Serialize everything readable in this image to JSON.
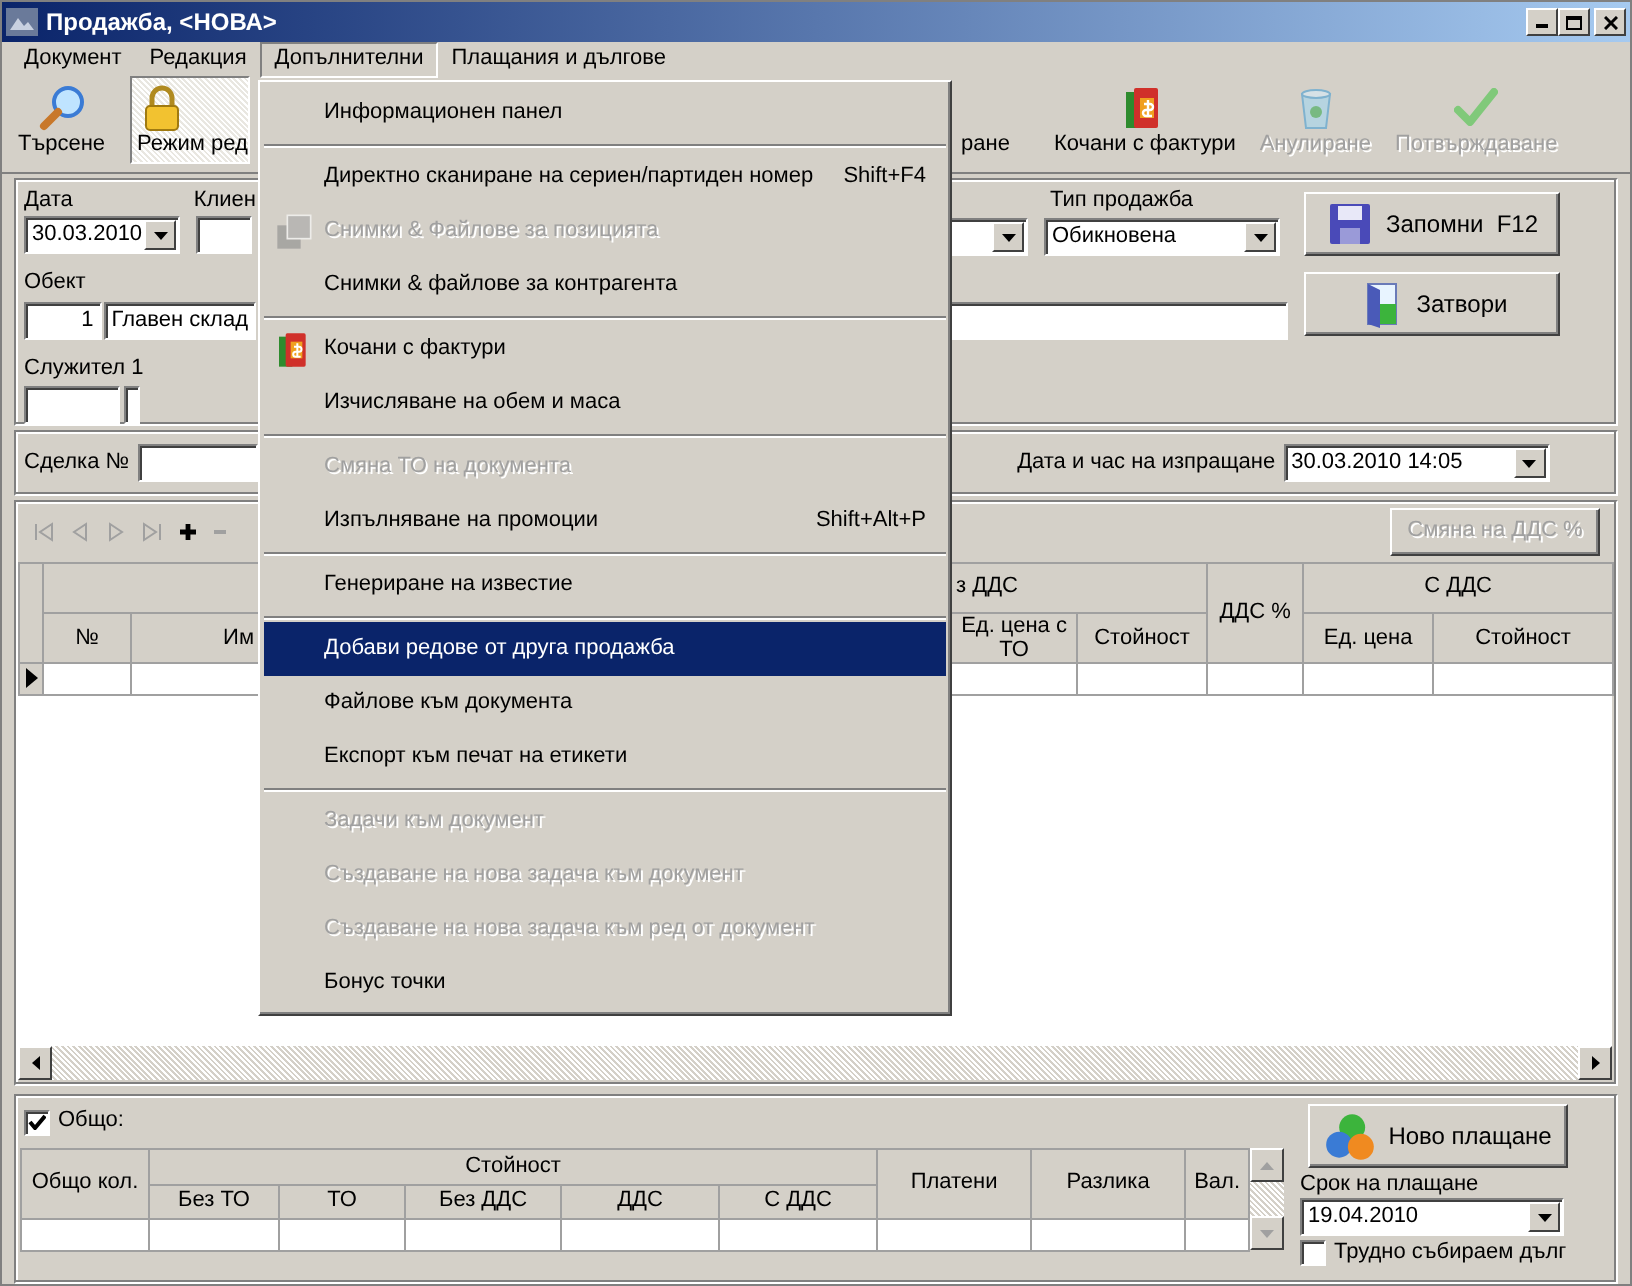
{
  "window": {
    "title": "Продажба, <НОВА>"
  },
  "menu_bar": [
    {
      "label": "Документ",
      "selected": false
    },
    {
      "label": "Редакция",
      "selected": false
    },
    {
      "label": "Допълнителни",
      "selected": true
    },
    {
      "label": "Плащания и дългове",
      "selected": false
    }
  ],
  "toolbar_left": [
    {
      "label": "Търсене",
      "kind": "search",
      "pressed": false,
      "disabled": false
    },
    {
      "label": "Режим ред",
      "kind": "lock",
      "pressed": true,
      "disabled": false
    }
  ],
  "toolbar_right": [
    {
      "label": "ране",
      "pressed": false,
      "disabled": false
    },
    {
      "label": "Кочани с фактури",
      "kind": "books",
      "pressed": false,
      "disabled": false
    },
    {
      "label": "Анулиране",
      "kind": "bin",
      "pressed": false,
      "disabled": true
    },
    {
      "label": "Потвърждаване",
      "kind": "check",
      "pressed": false,
      "disabled": true
    }
  ],
  "header": {
    "date": {
      "label": "Дата",
      "value": "30.03.2010"
    },
    "client": {
      "label": "Клиен"
    },
    "sale_type": {
      "label": "Тип продажба",
      "value": "Обикновена"
    },
    "object": {
      "label": "Обект",
      "number": "1",
      "name": "Главен склад"
    },
    "employee": {
      "label": "Служител 1"
    },
    "buttons": [
      {
        "label": "Запомни  F12",
        "kind": "floppy"
      },
      {
        "label": "Затвори",
        "kind": "door"
      }
    ]
  },
  "deal": {
    "label": "Сделка №"
  },
  "send_datetime": {
    "label": "Дата и час на изпращане",
    "value": "30.03.2010 14:05"
  },
  "grid": {
    "vat_button": {
      "label": "Смяна на ДДС %",
      "disabled": true
    },
    "number_column": "№",
    "name_column": "Им",
    "group_partial": "з ДДС",
    "group_columns": [
      "Ед. цена с ТО",
      "Стойност"
    ],
    "vat_column": "ДДС %",
    "with_vat": {
      "label": "С ДДС",
      "columns": [
        "Ед. цена",
        "Стойност"
      ]
    },
    "rows": [
      {
        "selected": true
      }
    ]
  },
  "totals": {
    "checkbox": {
      "label": "Общо:",
      "checked": true
    },
    "qty_column": "Общо кол.",
    "value_group": "Стойност",
    "value_columns": [
      "Без ТО",
      "ТО",
      "Без ДДС",
      "ДДС",
      "С ДДС"
    ],
    "paid_column": "Платени",
    "diff_column": "Разлика",
    "currency_column": "Вал."
  },
  "payment": {
    "button": "Ново плащане",
    "due": {
      "label": "Срок на плащане",
      "value": "19.04.2010"
    },
    "bad_debt": {
      "label": "Трудно събираем дълг",
      "checked": false
    }
  },
  "dropdown_menu": {
    "sections": [
      [
        {
          "label": "Информационен панел",
          "disabled": false,
          "selected": false
        }
      ],
      [
        {
          "label": "Директно сканиране на сериен/партиден номер",
          "shortcut": "Shift+F4",
          "disabled": false,
          "selected": false
        },
        {
          "label": "Снимки & Файлове за позицията",
          "kind": "photos",
          "disabled": true,
          "selected": false
        },
        {
          "label": "Снимки & файлове за контрагента",
          "disabled": false,
          "selected": false
        }
      ],
      [
        {
          "label": "Кочани с фактури",
          "kind": "books",
          "disabled": false,
          "selected": false
        },
        {
          "label": "Изчисляване на обем и маса",
          "disabled": false,
          "selected": false
        }
      ],
      [
        {
          "label": "Смяна ТО на документа",
          "disabled": true,
          "selected": false
        },
        {
          "label": "Изпълняване на промоции",
          "shortcut": "Shift+Alt+P",
          "disabled": false,
          "selected": false
        }
      ],
      [
        {
          "label": "Генериране на известие",
          "disabled": false,
          "selected": false
        }
      ],
      [
        {
          "label": "Добави редове от друга продажба",
          "disabled": false,
          "selected": true
        },
        {
          "label": "Файлове към документа",
          "disabled": false,
          "selected": false
        },
        {
          "label": "Експорт към печат на етикети",
          "disabled": false,
          "selected": false
        }
      ],
      [
        {
          "label": "Задачи към документ",
          "disabled": true,
          "selected": false
        },
        {
          "label": "Създаване на нова задача към документ",
          "disabled": true,
          "selected": false
        },
        {
          "label": "Създаване на нова задача към ред от документ",
          "disabled": true,
          "selected": false
        },
        {
          "label": "Бонус точки",
          "disabled": false,
          "selected": false
        }
      ]
    ]
  }
}
